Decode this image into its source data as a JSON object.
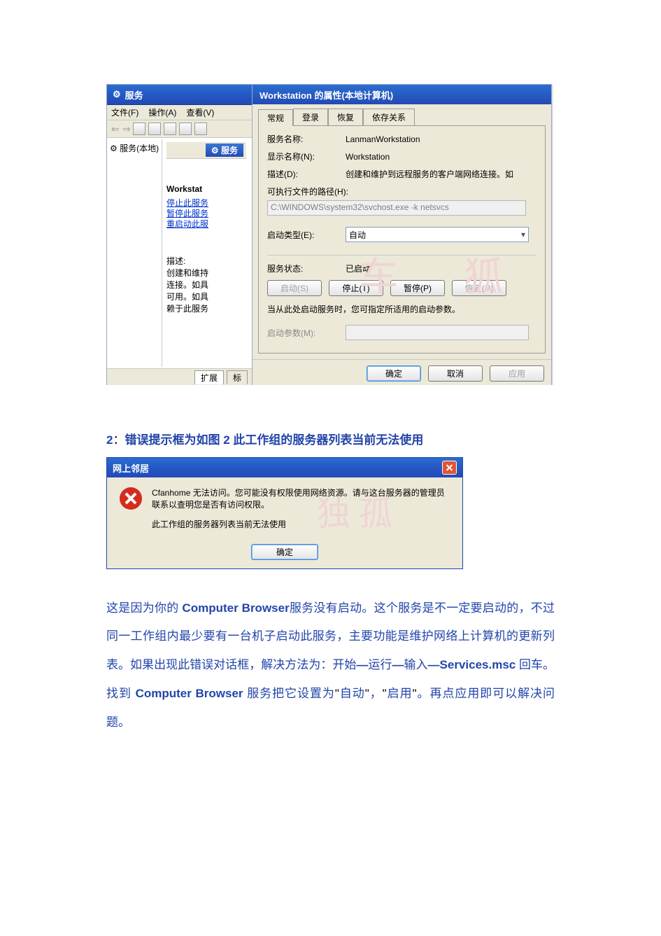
{
  "svc_window": {
    "title_icon": "⚙",
    "title": "服务",
    "menus": [
      "文件(F)",
      "操作(A)",
      "查看(V)"
    ],
    "tree_label_icon": "⚙",
    "tree_label": "服务(本地)",
    "pane_title_icon": "⚙",
    "pane_title": "服务",
    "selected_service": "Workstat",
    "actions": [
      "停止此服务",
      "暂停此服务",
      "重启动此服"
    ],
    "desc_label": "描述:",
    "desc_lines": [
      "创建和维持",
      "连接。如具",
      "可用。如具",
      "赖于此服务"
    ],
    "bottom_tabs": [
      "扩展",
      "标"
    ]
  },
  "prop_dialog": {
    "title": "Workstation 的属性(本地计算机)",
    "tabs": [
      "常规",
      "登录",
      "恢复",
      "依存关系"
    ],
    "rows": {
      "service_name_lbl": "服务名称:",
      "service_name_val": "LanmanWorkstation",
      "display_name_lbl": "显示名称(N):",
      "display_name_val": "Workstation",
      "desc_lbl": "描述(D):",
      "desc_val": "创建和维护到远程服务的客户端网络连接。如",
      "exe_lbl": "可执行文件的路径(H):",
      "exe_val": "C:\\WINDOWS\\system32\\svchost.exe -k netsvcs",
      "start_type_lbl": "启动类型(E):",
      "start_type_val": "自动",
      "status_lbl": "服务状态:",
      "status_val": "已启动"
    },
    "service_buttons": {
      "start": "启动(S)",
      "stop": "停止(T)",
      "pause": "暂停(P)",
      "resume": "恢复(R)"
    },
    "hint": "当从此处启动服务时，您可指定所适用的启动参数。",
    "param_lbl": "启动参数(M):",
    "param_val": "",
    "dlg_buttons": {
      "ok": "确定",
      "cancel": "取消",
      "apply": "应用"
    }
  },
  "heading2": {
    "num": "2",
    "sep": "：",
    "rest_blue_a": "错误提示框为如图 ",
    "rest_num2": "2",
    "rest_blue_b": " 此工作组的服务器列表当前无法使用"
  },
  "dlg2": {
    "title": "网上邻居",
    "line1": "Cfanhome 无法访问。您可能没有权限使用网络资源。请与这台服务器的管理员联系以查明您是否有访问权限。",
    "line2": "此工作组的服务器列表当前无法使用",
    "ok": "确定"
  },
  "para": {
    "t1": "这是因为你的 ",
    "t2": "Computer  Browser",
    "t3": "服务没有启动。这个服务是不一定要启动的，不过同一工作组内最少要有一台机子启动此服务，主要功能是维护网络上计算机的更新列表。如果出现此错误对话框，解决方法为：开始",
    "dash1": "—",
    "t4": "运行",
    "dash2": "—",
    "t5": "输入",
    "dash3": "—",
    "t6": "Services.msc",
    "t7": " 回车。找到 ",
    "t8": "Computer Browser ",
    "t9": "服务把它设置为",
    "q1": "\"",
    "t10": "自动",
    "q2": "\"",
    "t11": "，",
    "q3": "\"",
    "t12": "启用",
    "q4": "\"",
    "t13": "。再点应用即可以解决问题。"
  }
}
